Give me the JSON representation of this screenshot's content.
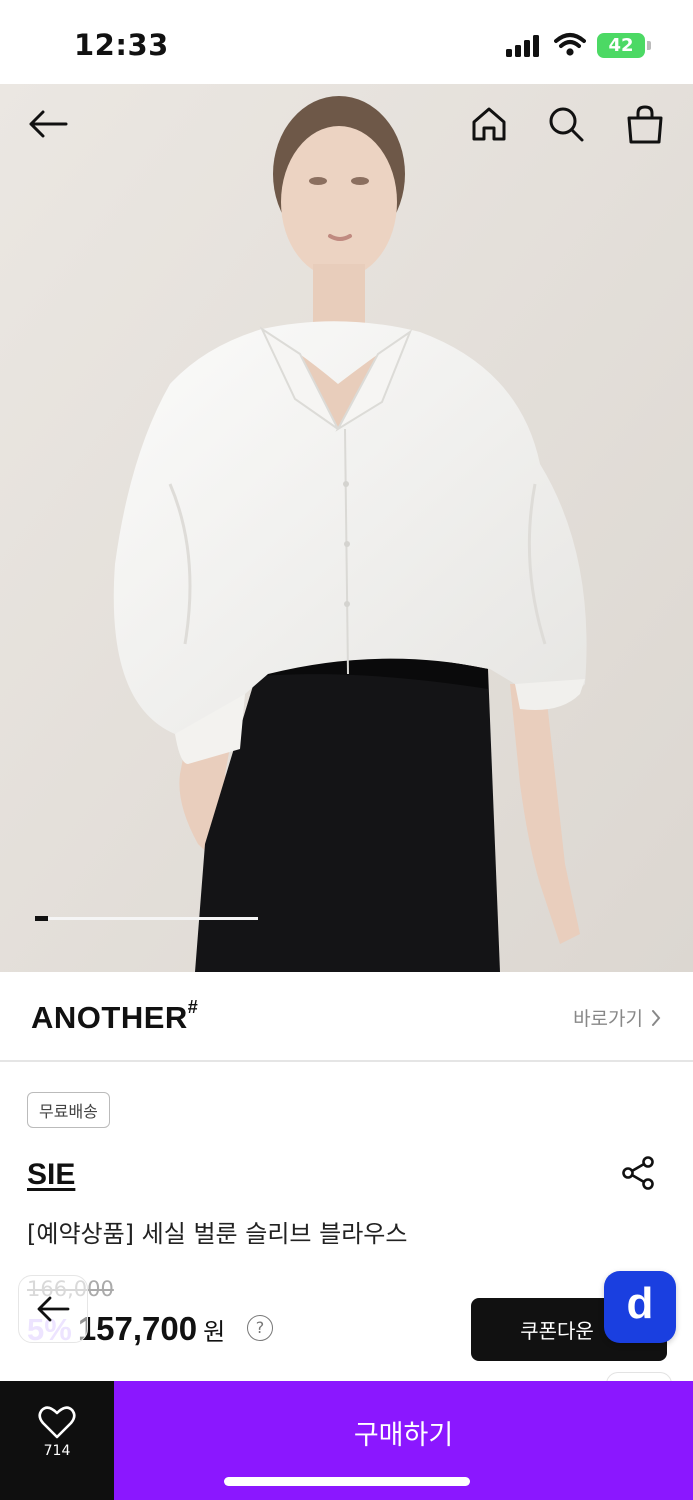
{
  "status": {
    "time": "12:33",
    "battery": "42"
  },
  "nav": {
    "back_icon": "arrow-left-icon",
    "home_icon": "home-icon",
    "search_icon": "search-icon",
    "bag_icon": "shopping-bag-icon"
  },
  "gallery": {
    "progress": 0.06
  },
  "brand": {
    "name": "ANOTHER",
    "mark": "#",
    "link_label": "바로가기"
  },
  "product": {
    "badge": "무료배송",
    "seller": "SIE",
    "title": "[예약상품] 세실 벌룬 슬리브 블라우스",
    "price_original": "166,000",
    "discount": "5%",
    "price": "157,700",
    "currency_unit": "원",
    "help_label": "?"
  },
  "actions": {
    "coupon_label": "쿠폰다운",
    "app_badge": "d",
    "like_count": "714",
    "buy_label": "구매하기"
  },
  "colors": {
    "accent": "#8b17ff",
    "discount": "#d7c3ff",
    "app_badge": "#1a3fe0",
    "dark": "#111111"
  }
}
